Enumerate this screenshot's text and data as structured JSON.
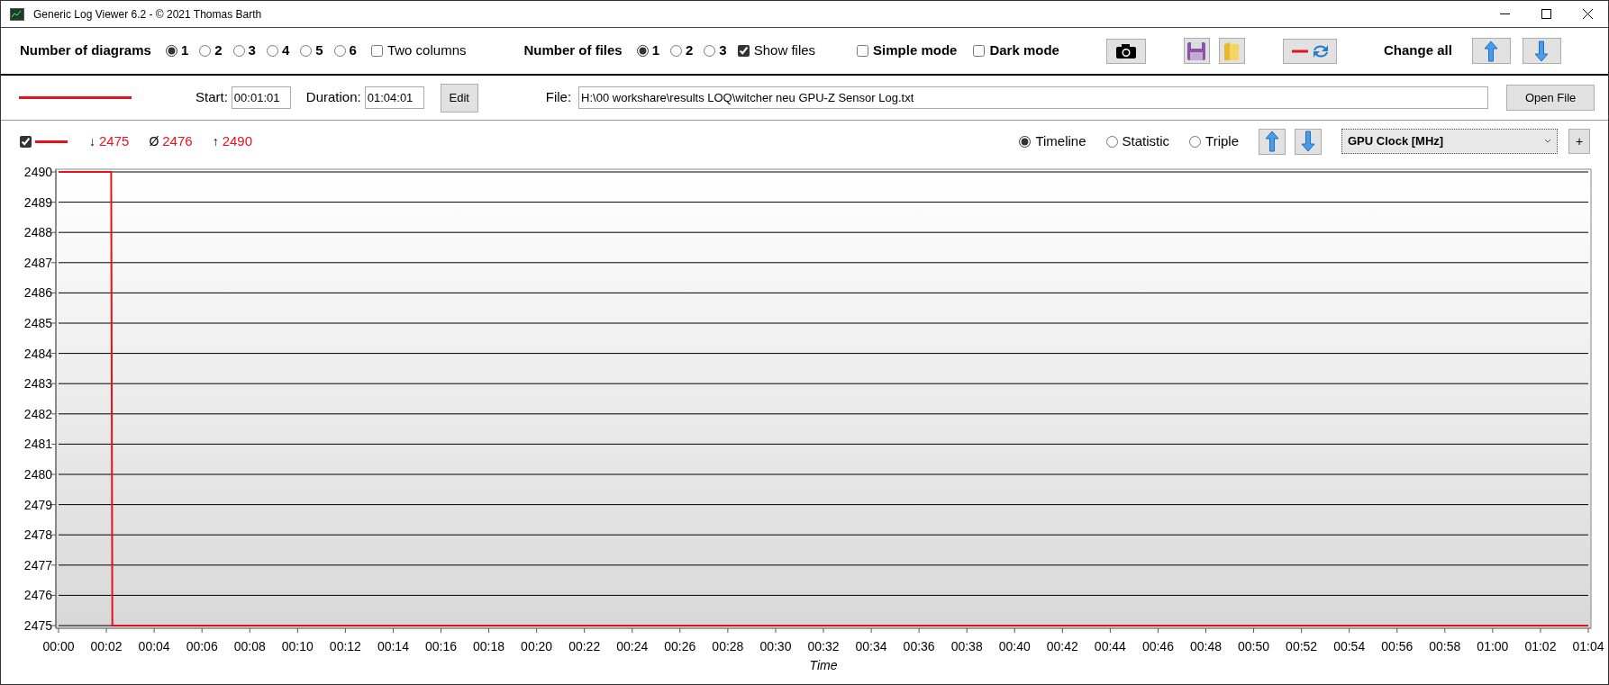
{
  "window": {
    "title": "Generic Log Viewer 6.2 - © 2021 Thomas Barth"
  },
  "toolbar": {
    "diagrams": {
      "label": "Number of diagrams",
      "options": [
        {
          "label": "1",
          "selected": true
        },
        {
          "label": "2",
          "selected": false
        },
        {
          "label": "3",
          "selected": false
        },
        {
          "label": "4",
          "selected": false
        },
        {
          "label": "5",
          "selected": false
        },
        {
          "label": "6",
          "selected": false
        }
      ]
    },
    "two_columns": {
      "label": "Two columns",
      "checked": false
    },
    "files": {
      "label": "Number of files",
      "options": [
        {
          "label": "1",
          "selected": true
        },
        {
          "label": "2",
          "selected": false
        },
        {
          "label": "3",
          "selected": false
        }
      ]
    },
    "show_files": {
      "label": "Show files",
      "checked": true
    },
    "simple_mode": {
      "label": "Simple mode",
      "checked": false
    },
    "dark_mode": {
      "label": "Dark mode",
      "checked": false
    },
    "change_all": "Change all"
  },
  "file_bar": {
    "start_label": "Start:",
    "start": "00:01:01",
    "duration_label": "Duration:",
    "duration": "01:04:01",
    "edit_button": "Edit",
    "file_label": "File:",
    "file_path": "H:\\00 workshare\\results LOQ\\witcher neu GPU-Z Sensor Log.txt",
    "open_button": "Open File"
  },
  "diagram": {
    "visible": {
      "checked": true
    },
    "min_icon": "↓",
    "min": "2475",
    "avg_icon": "Ø",
    "avg": "2476",
    "max_icon": "↑",
    "max": "2490",
    "views": [
      {
        "label": "Timeline",
        "selected": true
      },
      {
        "label": "Statistic",
        "selected": false
      },
      {
        "label": "Triple",
        "selected": false
      }
    ],
    "add_button": "+",
    "chart_data": {
      "type": "line",
      "xlabel": "Time",
      "grid": true,
      "x": [
        0,
        2.2,
        2.25,
        64
      ],
      "series": [
        {
          "name": "GPU Clock [MHz]",
          "color": "#e8101a",
          "values": [
            2490,
            2490,
            2475,
            2475
          ]
        }
      ],
      "xlim": [
        0,
        64
      ],
      "ylim": [
        2475,
        2490
      ],
      "xticks": [
        {
          "value": 0,
          "label": "00:00"
        },
        {
          "value": 2,
          "label": "00:02"
        },
        {
          "value": 4,
          "label": "00:04"
        },
        {
          "value": 6,
          "label": "00:06"
        },
        {
          "value": 8,
          "label": "00:08"
        },
        {
          "value": 10,
          "label": "00:10"
        },
        {
          "value": 12,
          "label": "00:12"
        },
        {
          "value": 14,
          "label": "00:14"
        },
        {
          "value": 16,
          "label": "00:16"
        },
        {
          "value": 18,
          "label": "00:18"
        },
        {
          "value": 20,
          "label": "00:20"
        },
        {
          "value": 22,
          "label": "00:22"
        },
        {
          "value": 24,
          "label": "00:24"
        },
        {
          "value": 26,
          "label": "00:26"
        },
        {
          "value": 28,
          "label": "00:28"
        },
        {
          "value": 30,
          "label": "00:30"
        },
        {
          "value": 32,
          "label": "00:32"
        },
        {
          "value": 34,
          "label": "00:34"
        },
        {
          "value": 36,
          "label": "00:36"
        },
        {
          "value": 38,
          "label": "00:38"
        },
        {
          "value": 40,
          "label": "00:40"
        },
        {
          "value": 42,
          "label": "00:42"
        },
        {
          "value": 44,
          "label": "00:44"
        },
        {
          "value": 46,
          "label": "00:46"
        },
        {
          "value": 48,
          "label": "00:48"
        },
        {
          "value": 50,
          "label": "00:50"
        },
        {
          "value": 52,
          "label": "00:52"
        },
        {
          "value": 54,
          "label": "00:54"
        },
        {
          "value": 56,
          "label": "00:56"
        },
        {
          "value": 58,
          "label": "00:58"
        },
        {
          "value": 60,
          "label": "01:00"
        },
        {
          "value": 62,
          "label": "01:02"
        },
        {
          "value": 64,
          "label": "01:04"
        }
      ],
      "yticks": [
        2475,
        2476,
        2477,
        2478,
        2479,
        2480,
        2481,
        2482,
        2483,
        2484,
        2485,
        2486,
        2487,
        2488,
        2489,
        2490
      ]
    }
  }
}
